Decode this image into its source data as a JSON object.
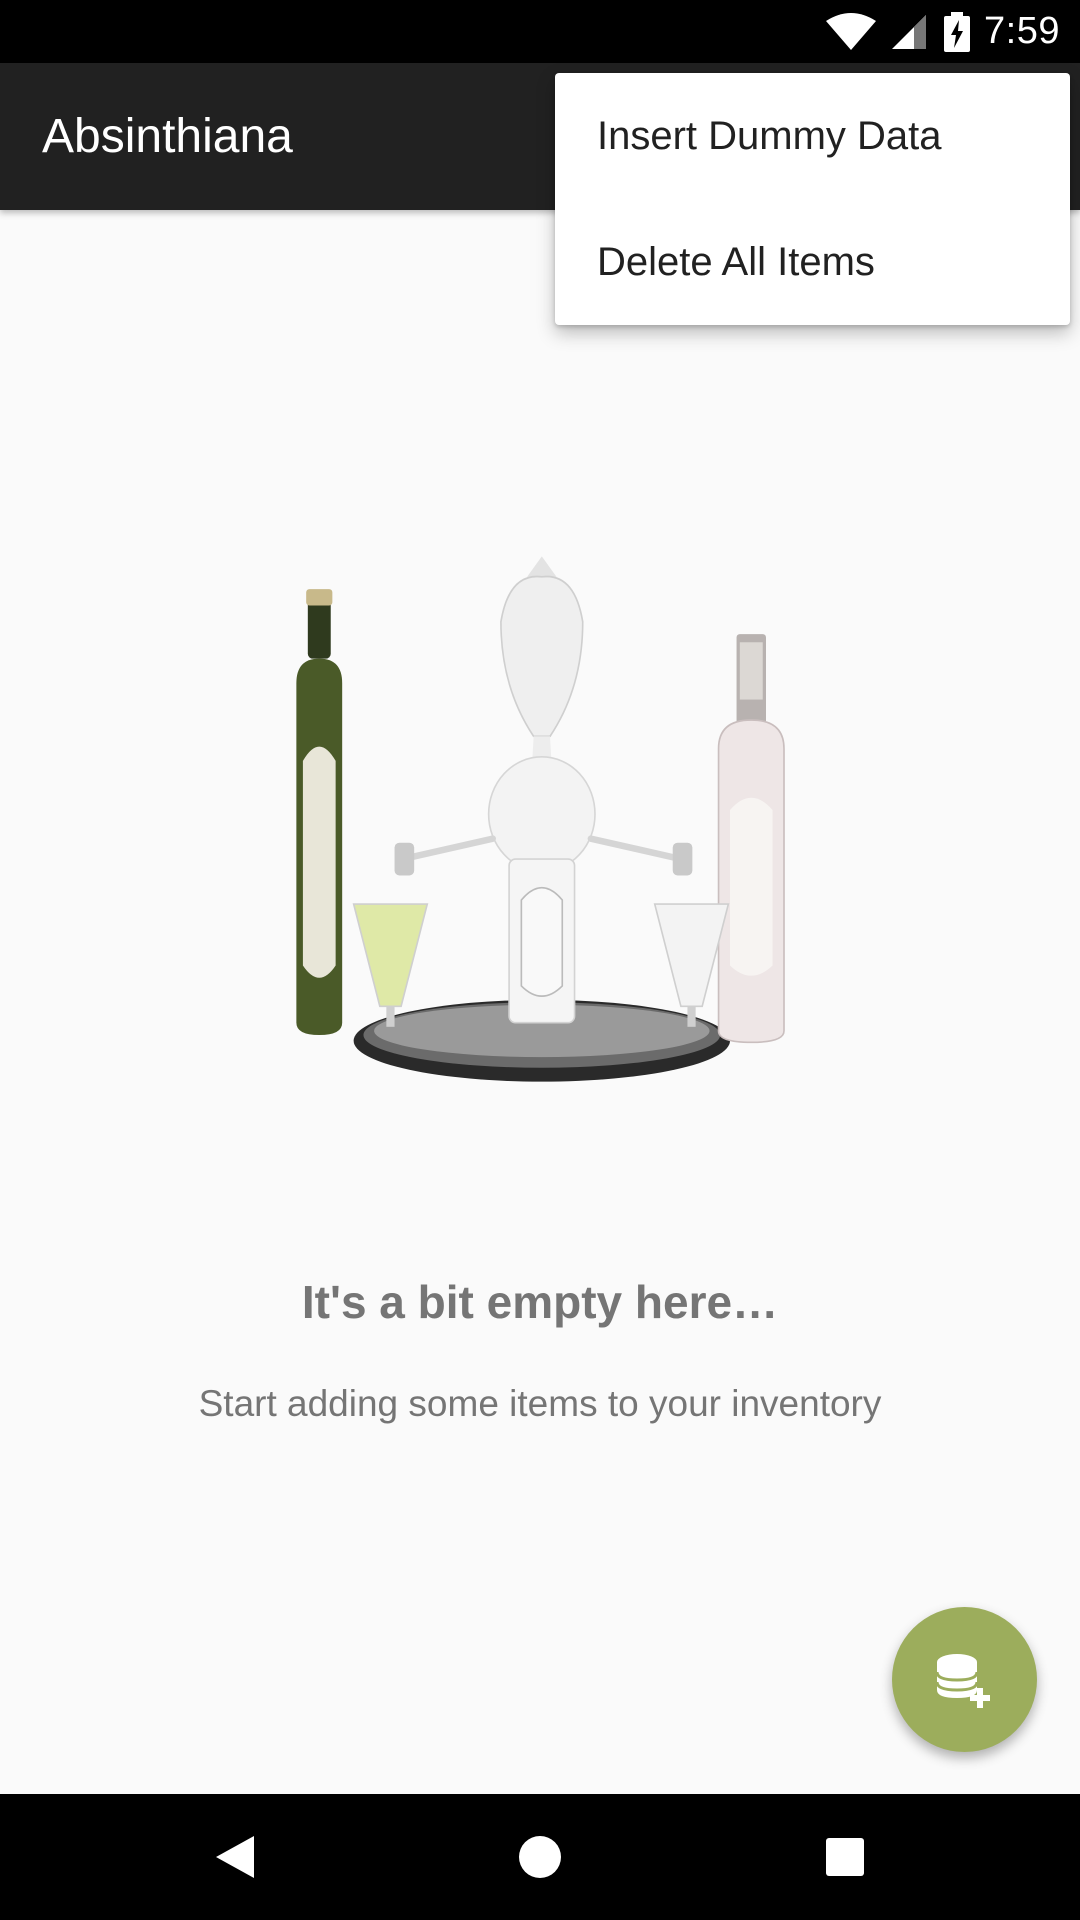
{
  "status_bar": {
    "time": "7:59",
    "icons": [
      "wifi-icon",
      "signal-icon",
      "battery-charging-icon"
    ]
  },
  "app_bar": {
    "title": "Absinthiana",
    "background_color": "#212121"
  },
  "overflow_menu": {
    "items": [
      {
        "label": "Insert Dummy Data"
      },
      {
        "label": "Delete All Items"
      }
    ]
  },
  "empty_state": {
    "image": "absinthe-fountain-and-bottles-illustration",
    "title": "It's a bit empty here…",
    "subtitle": "Start adding some items to your inventory"
  },
  "fab": {
    "icon": "database-add-icon",
    "color": "#9cad5c"
  },
  "nav_bar": {
    "buttons": [
      "back-icon",
      "home-icon",
      "recents-icon"
    ]
  }
}
